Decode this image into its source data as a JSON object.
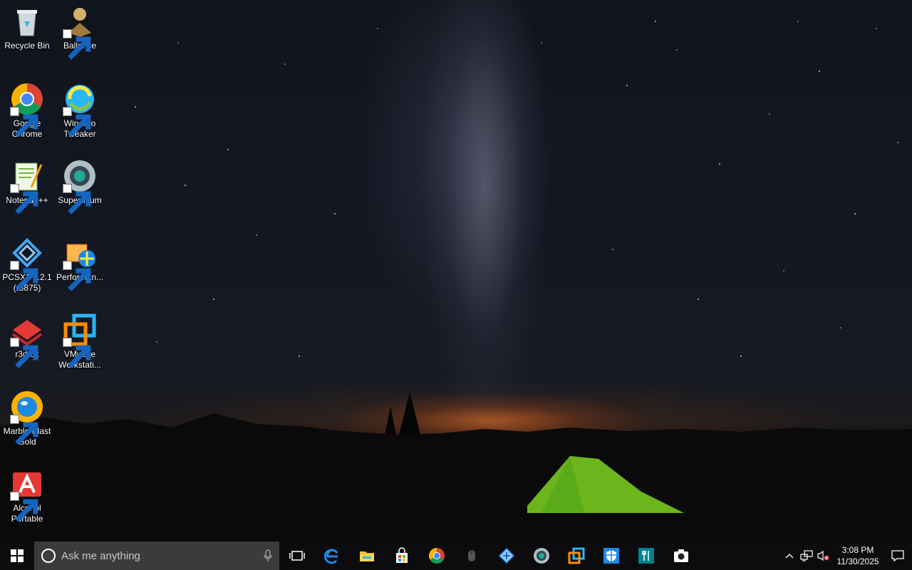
{
  "desktop": {
    "icons": [
      {
        "label": "Recycle Bin",
        "icon": "recycle-bin-icon"
      },
      {
        "label": "Ballance",
        "icon": "ballance-icon"
      },
      {
        "label": "Google Chrome",
        "icon": "chrome-icon"
      },
      {
        "label": "Winaero Tweaker",
        "icon": "winaero-tweaker-icon"
      },
      {
        "label": "Notepad++",
        "icon": "notepad-plus-plus-icon"
      },
      {
        "label": "Supermium",
        "icon": "supermium-icon"
      },
      {
        "label": "PCSX2 1.2.1 (r5875)",
        "icon": "pcsx2-icon"
      },
      {
        "label": "Performan...",
        "icon": "performance-icon"
      },
      {
        "label": "r3dfox",
        "icon": "r3dfox-icon"
      },
      {
        "label": "VMware Workstati...",
        "icon": "vmware-workstation-icon"
      },
      {
        "label": "Marble Blast Gold",
        "icon": "marble-blast-icon"
      },
      {
        "label": "Alcohol Portable",
        "icon": "alcohol-portable-icon"
      }
    ]
  },
  "taskbar": {
    "search_placeholder": "Ask me anything",
    "pinned": [
      "task-view-icon",
      "edge-icon",
      "file-explorer-icon",
      "store-icon",
      "chrome-icon",
      "mouse-icon",
      "network-app-icon",
      "supermium-icon",
      "vmware-icon",
      "security-shield-icon",
      "restaurant-app-icon",
      "camera-icon"
    ],
    "clock_time": "3:08 PM",
    "clock_date": "11/30/2025"
  },
  "colors": {
    "taskbar_bg": "#0c0c0f",
    "search_bg": "#3b3b3b",
    "accent": "#1e88e5"
  }
}
